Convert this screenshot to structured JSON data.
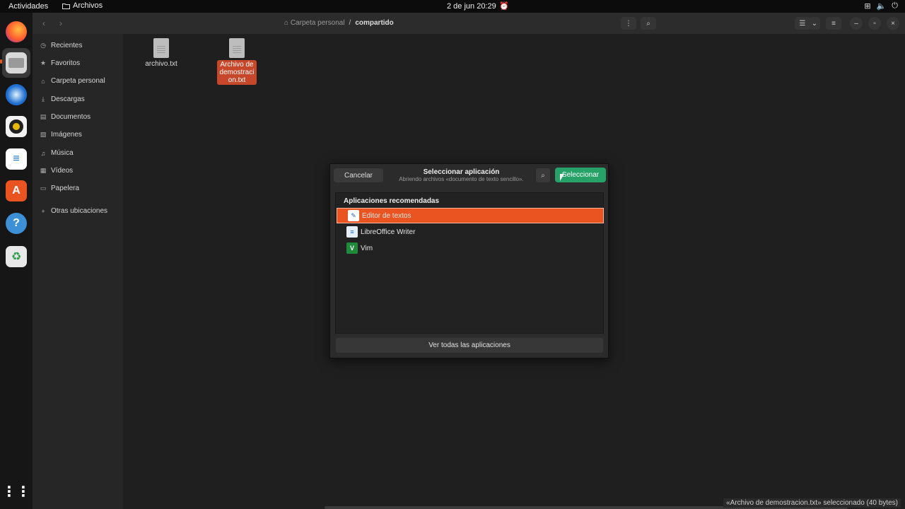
{
  "topbar": {
    "activities": "Actividades",
    "app_name": "Archivos",
    "clock": "2 de jun  20:29"
  },
  "dock": {
    "apps": [
      {
        "name": "firefox-icon"
      },
      {
        "name": "files-icon"
      },
      {
        "name": "thunderbird-icon"
      },
      {
        "name": "rhythmbox-icon"
      },
      {
        "name": "libreoffice-writer-icon"
      },
      {
        "name": "software-center-icon"
      },
      {
        "name": "help-icon"
      },
      {
        "name": "trash-icon"
      }
    ],
    "show_apps": "show-applications-icon"
  },
  "header": {
    "breadcrumb_home": "Carpeta personal",
    "breadcrumb_separator": "/",
    "breadcrumb_current": "compartido"
  },
  "sidebar": {
    "items": [
      {
        "label": "Recientes",
        "icon": "clock-icon"
      },
      {
        "label": "Favoritos",
        "icon": "star-icon"
      },
      {
        "label": "Carpeta personal",
        "icon": "home-icon"
      },
      {
        "label": "Descargas",
        "icon": "download-icon"
      },
      {
        "label": "Documentos",
        "icon": "document-icon"
      },
      {
        "label": "Imágenes",
        "icon": "image-icon"
      },
      {
        "label": "Música",
        "icon": "music-icon"
      },
      {
        "label": "Vídeos",
        "icon": "video-icon"
      },
      {
        "label": "Papelera",
        "icon": "trash-icon"
      },
      {
        "label": "Otras ubicaciones",
        "icon": "plus-icon"
      }
    ]
  },
  "files": [
    {
      "name": "archivo.txt",
      "selected": false
    },
    {
      "name": "Archivo de demostracion.txt",
      "display": "Archivo de\ndemostraci\non.txt",
      "selected": true
    }
  ],
  "dialog": {
    "cancel": "Cancelar",
    "title": "Seleccionar aplicación",
    "subtitle": "Abriendo archivos «documento de texto sencillo».",
    "select": "Seleccionar",
    "section_heading": "Aplicaciones recomendadas",
    "apps": [
      {
        "label": "Editor de textos",
        "selected": true
      },
      {
        "label": "LibreOffice Writer",
        "selected": false
      },
      {
        "label": "Vim",
        "selected": false
      }
    ],
    "view_all": "Ver todas las aplicaciones"
  },
  "status": {
    "text": "«Archivo de demostracion.txt» seleccionado  (40 bytes)"
  },
  "colors": {
    "accent": "#e95420",
    "selected_file": "#c7472a",
    "confirm": "#26a269"
  }
}
